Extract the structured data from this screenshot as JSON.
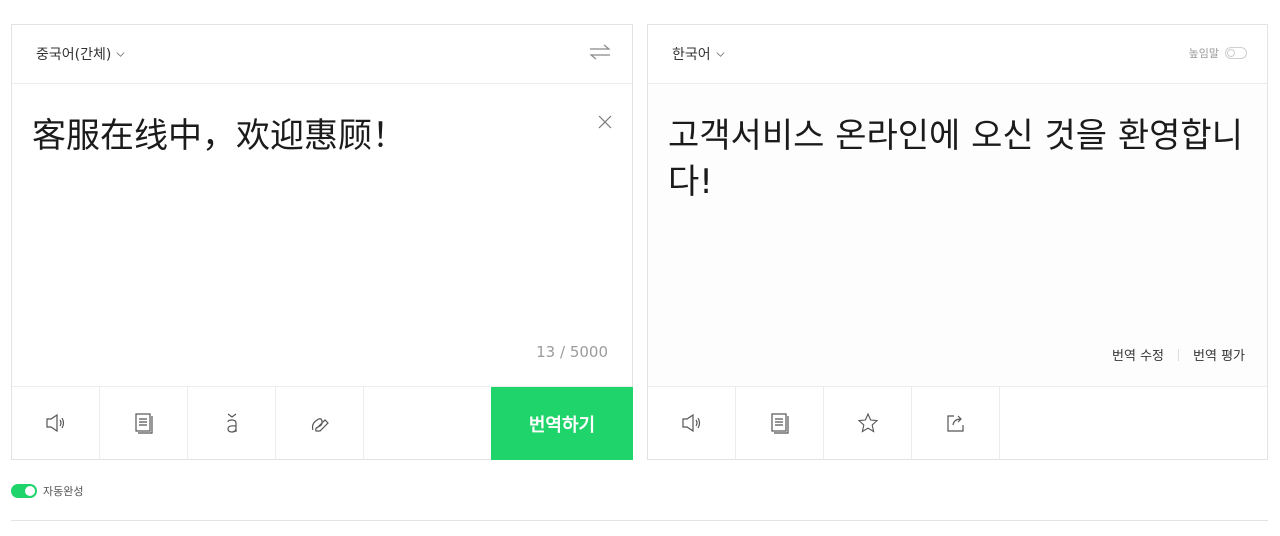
{
  "source": {
    "language": "중국어(간체)",
    "text": "客服在线中，欢迎惠顾！",
    "char_count": "13 / 5000",
    "translate_label": "번역하기"
  },
  "target": {
    "language": "한국어",
    "honorific_label": "높임말",
    "text": "고객서비스 온라인에 오신 것을 환영합니다!",
    "edit_label": "번역 수정",
    "rate_label": "번역 평가"
  },
  "autocomplete_label": "자동완성",
  "colors": {
    "accent": "#1fd46a"
  }
}
